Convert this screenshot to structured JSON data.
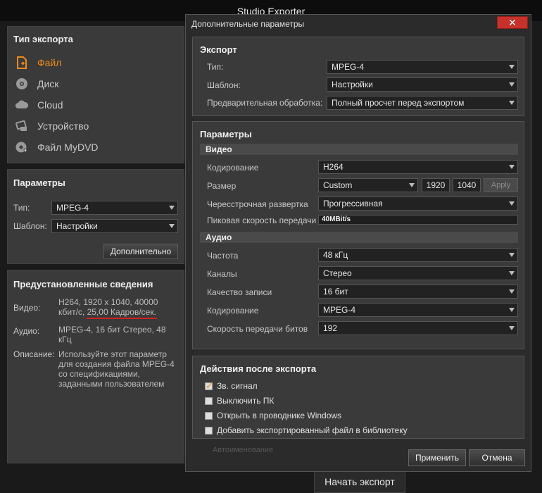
{
  "app": {
    "title": "Studio Exporter"
  },
  "export_type": {
    "title": "Тип экспорта",
    "items": [
      {
        "label": "Файл",
        "icon": "file-icon",
        "active": true
      },
      {
        "label": "Диск",
        "icon": "disc-icon",
        "active": false
      },
      {
        "label": "Cloud",
        "icon": "cloud-icon",
        "active": false
      },
      {
        "label": "Устройство",
        "icon": "device-icon",
        "active": false
      },
      {
        "label": "Файл MyDVD",
        "icon": "mydvd-icon",
        "active": false
      }
    ]
  },
  "params": {
    "title": "Параметры",
    "type_label": "Тип:",
    "type_value": "MPEG-4",
    "template_label": "Шаблон:",
    "template_value": "Настройки",
    "more_button": "Дополнительно"
  },
  "preset": {
    "title": "Предустановленные сведения",
    "video_label": "Видео:",
    "video_line1": "H264, 1920 x 1040, 40000",
    "video_line2": "кбит/с, 25,00 Кадров/сек.",
    "audio_label": "Аудио:",
    "audio_line1": "MPEG-4, 16 бит Стерео, 48",
    "audio_line2": "кГц",
    "desc_label": "Описание:",
    "desc_line1": "Используйте этот параметр",
    "desc_line2": "для создания файла MPEG-4",
    "desc_line3": "со спецификациями,",
    "desc_line4": "заданными пользователем"
  },
  "start_button": "Начать экспорт",
  "dialog": {
    "title": "Дополнительные параметры",
    "close": "✕",
    "export": {
      "title": "Экспорт",
      "type_label": "Тип:",
      "type_value": "MPEG-4",
      "template_label": "Шаблон:",
      "template_value": "Настройки",
      "preprocess_label": "Предварительная обработка:",
      "preprocess_value": "Полный просчет перед экспортом"
    },
    "parameters": {
      "title": "Параметры",
      "video_header": "Видео",
      "encoding_label": "Кодирование",
      "encoding_value": "H264",
      "size_label": "Размер",
      "size_value": "Custom",
      "width": "1920",
      "height": "1040",
      "apply": "Apply",
      "interlace_label": "Чересстрочная развертка",
      "interlace_value": "Прогрессивная",
      "peak_label": "Пиковая скорость передачи",
      "peak_value": "40MBit/s",
      "audio_header": "Аудио",
      "freq_label": "Частота",
      "freq_value": "48 кГц",
      "channels_label": "Каналы",
      "channels_value": "Стерео",
      "quality_label": "Качество записи",
      "quality_value": "16 бит",
      "aenc_label": "Кодирование",
      "aenc_value": "MPEG-4",
      "bitrate_label": "Скорость передачи битов",
      "bitrate_value": "192"
    },
    "post": {
      "title": "Действия после экспорта",
      "items": [
        {
          "label": "Зв. сигнал",
          "checked": true
        },
        {
          "label": "Выключить ПК",
          "checked": false
        },
        {
          "label": "Открыть в проводнике Windows",
          "checked": false
        },
        {
          "label": "Добавить экспортированный файл в библиотеку",
          "checked": false
        }
      ]
    },
    "ghost_text": "Автоименование",
    "apply_button": "Применить",
    "cancel_button": "Отмена"
  },
  "colors": {
    "accent": "#f08a1c",
    "close": "#c8312b",
    "underline": "#d22020"
  }
}
